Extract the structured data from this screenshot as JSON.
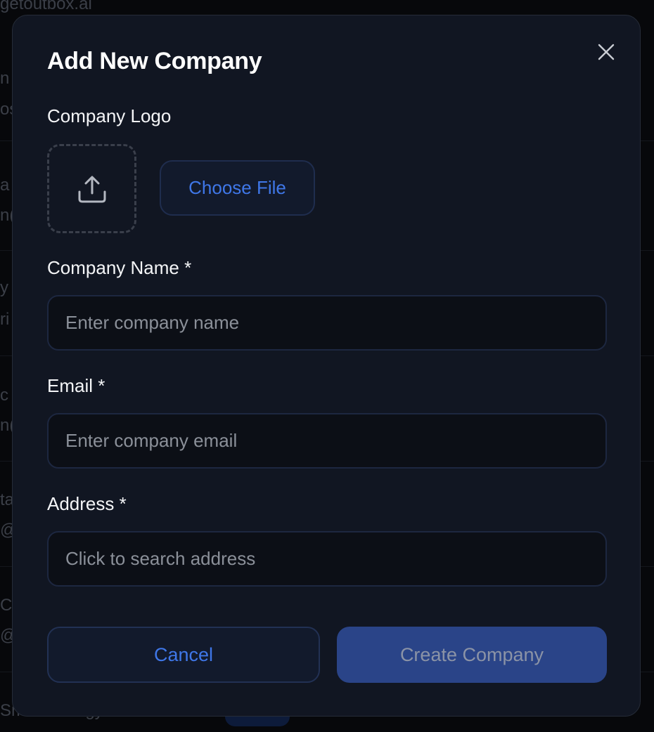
{
  "background": {
    "fragments": [
      {
        "text": "getoutbox.ai"
      },
      {
        "text": "n"
      },
      {
        "text": "os"
      },
      {
        "text": "a"
      },
      {
        "text": "n("
      },
      {
        "text": "y"
      },
      {
        "text": "ri"
      },
      {
        "text": "c"
      },
      {
        "text": "n("
      },
      {
        "text": "ta"
      },
      {
        "text": "@"
      },
      {
        "text": "Co"
      },
      {
        "text": "@"
      },
      {
        "text": "Smart Energy Solutions"
      }
    ]
  },
  "modal": {
    "title": "Add New Company",
    "close_icon": "close-icon",
    "logo": {
      "label": "Company Logo",
      "upload_icon": "upload-icon",
      "choose_file_label": "Choose File"
    },
    "fields": {
      "company_name": {
        "label": "Company Name *",
        "placeholder": "Enter company name",
        "value": ""
      },
      "email": {
        "label": "Email *",
        "placeholder": "Enter company email",
        "value": ""
      },
      "address": {
        "label": "Address *",
        "placeholder": "Click to search address",
        "value": ""
      }
    },
    "actions": {
      "cancel_label": "Cancel",
      "create_label": "Create Company"
    }
  },
  "colors": {
    "accent": "#3f77e8",
    "primary_button": "#2a4488",
    "modal_bg": "#111622"
  }
}
